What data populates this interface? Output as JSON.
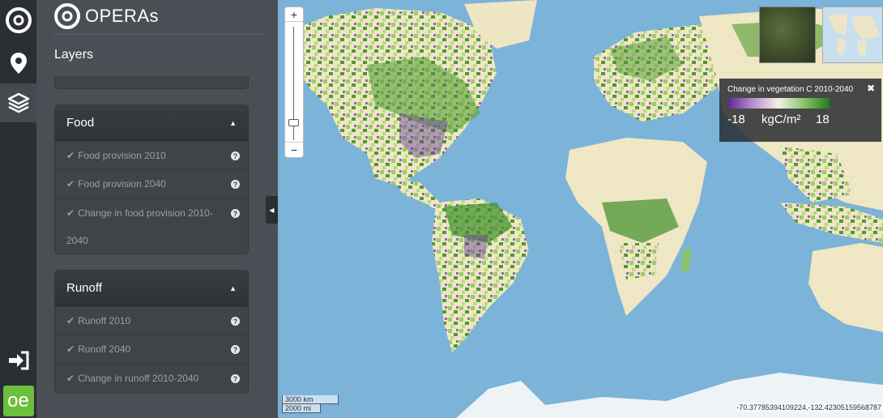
{
  "app": {
    "name": "OPERAs"
  },
  "panel": {
    "title": "Layers",
    "prev_group_tail": "2040",
    "groups": [
      {
        "name": "Food",
        "items": [
          {
            "label": "Food provision 2010"
          },
          {
            "label": "Food provision 2040"
          },
          {
            "label": "Change in food provision 2010-2040"
          }
        ]
      },
      {
        "name": "Runoff",
        "items": [
          {
            "label": "Runoff 2010"
          },
          {
            "label": "Runoff 2040"
          },
          {
            "label": "Change in runoff 2010-2040"
          }
        ]
      }
    ]
  },
  "map": {
    "zoom_in": "+",
    "zoom_out": "−",
    "legend": {
      "title": "Change in vegetation C 2010-2040",
      "min": "-18",
      "unit": "kgC/m²",
      "max": "18",
      "close": "✖",
      "colors": [
        "#5a2a8f",
        "#b890d0",
        "#f2f0e6",
        "#8cc46a",
        "#1e7a1e"
      ]
    },
    "scale": {
      "km": "3000 km",
      "mi": "2000 mi"
    },
    "coordinates": "-70.37785394109224,-132.42305159568787"
  },
  "rail": {
    "icons": [
      "opera-logo-icon",
      "map-marker-icon",
      "layers-icon",
      "sign-in-icon",
      "oe-logo-icon"
    ],
    "oe_label": "oe"
  },
  "colors": {
    "rail_bg": "#2b2f33",
    "panel_bg": "#4a4f55",
    "ocean": "#7bb3d9",
    "land": "#efe6c4",
    "veg_green": "#4f9a2f",
    "veg_purple": "#6a3d9a",
    "oe_green": "#6cbf3c"
  }
}
